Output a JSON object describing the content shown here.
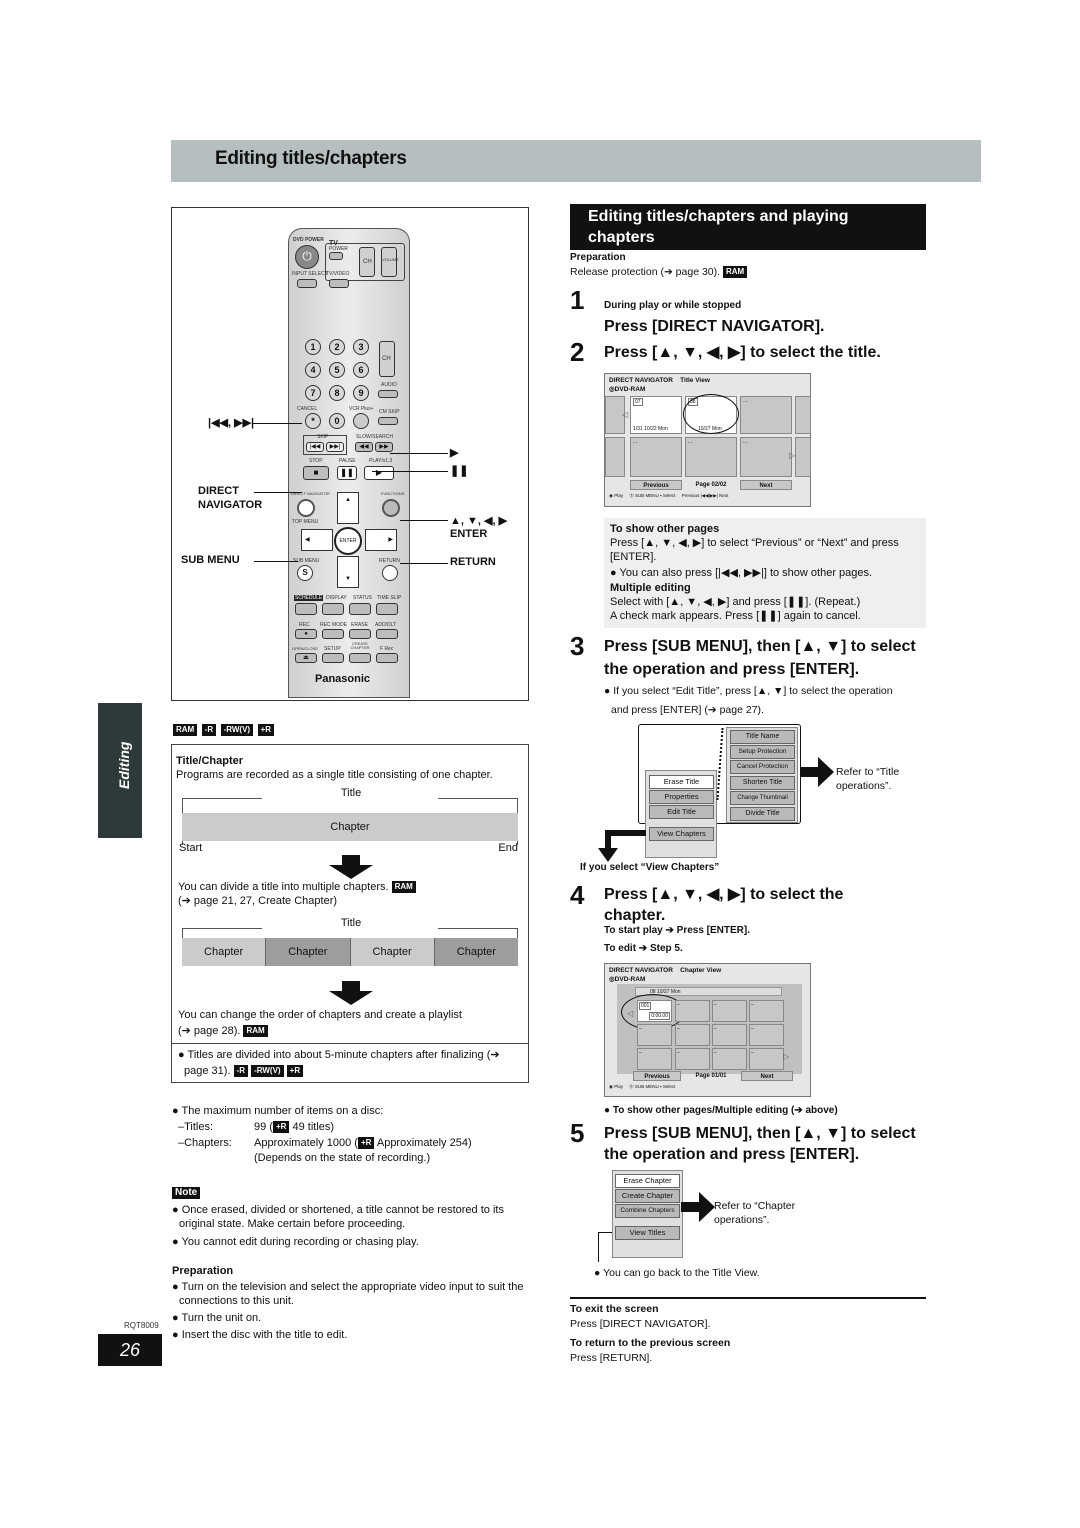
{
  "page": {
    "banner_title": "Editing titles/chapters",
    "side_tab": "Editing",
    "doc_code": "RQT8009",
    "page_number": "26"
  },
  "remote": {
    "labels": {
      "dvd_power": "DVD POWER",
      "tv": "TV",
      "power": "POWER",
      "input_select": "INPUT SELECT",
      "tv_video": "TV/VIDEO",
      "ch": "CH",
      "volume": "VOLUME",
      "audio": "AUDIO",
      "cancel": "CANCEL",
      "vcr_plus": "VCR Plus+",
      "cm_skip": "CM SKIP",
      "skip": "SKIP",
      "slow_search": "SLOW/SEARCH",
      "stop": "STOP",
      "pause": "PAUSE",
      "play": "PLAY/x1.3",
      "direct_navigator": "DIRECT NAVIGATOR",
      "functions": "FUNCTIONS",
      "top_menu": "TOP MENU",
      "enter": "ENTER",
      "sub_menu": "SUB MENU",
      "return": "RETURN",
      "schedule": "SCHEDULE",
      "display": "DISPLAY",
      "status": "STATUS",
      "time_slip": "TIME SLIP",
      "rec": "REC",
      "rec_mode": "REC MODE",
      "erase": "ERASE",
      "add_dlt": "ADD/DLT",
      "open_close": "OPEN/CLOSE",
      "setup": "SETUP",
      "create_chapter": "CREATE CHAPTER",
      "f_rec": "F Rec",
      "brand": "Panasonic"
    },
    "numbers": [
      "1",
      "2",
      "3",
      "4",
      "5",
      "6",
      "7",
      "8",
      "9",
      "0"
    ],
    "callouts": {
      "skip": "|◀◀, ▶▶|",
      "direct_navigator_1": "DIRECT",
      "direct_navigator_2": "NAVIGATOR",
      "sub_menu": "SUB MENU",
      "play": "▶",
      "pause": "❚❚",
      "arrows": "▲, ▼, ◀, ▶",
      "enter": "ENTER",
      "return": "RETURN"
    }
  },
  "media_badges": [
    "RAM",
    "-R",
    "-RW(V)",
    "+R"
  ],
  "title_chapter": {
    "heading": "Title/Chapter",
    "intro": "Programs are recorded as a single title consisting of one chapter.",
    "title_label": "Title",
    "chapter_label": "Chapter",
    "start": "Start",
    "end": "End",
    "divide_text": "You can divide a title into multiple chapters.",
    "divide_badge": "RAM",
    "divide_ref": "(➔ page 21, 27, Create Chapter)",
    "chapters": [
      "Chapter",
      "Chapter",
      "Chapter",
      "Chapter"
    ],
    "order_text": "You can change the order of chapters and create a playlist",
    "order_ref": "(➔ page 28).",
    "order_badge": "RAM",
    "finalize_text": "Titles are divided into about 5-minute chapters after finalizing (➔",
    "finalize_ref": "page 31).",
    "finalize_badges": [
      "-R",
      "-RW(V)",
      "+R"
    ]
  },
  "limits": {
    "intro": "The maximum number of items on a disc:",
    "titles_label": "–Titles:",
    "titles_value_pre": "99 (",
    "titles_badge": "+R",
    "titles_value_post": "49 titles)",
    "chapters_label": "–Chapters:",
    "chapters_value_pre": "Approximately 1000 (",
    "chapters_badge": "+R",
    "chapters_value_post": "Approximately 254)",
    "chapters_note": "(Depends on the state of recording.)"
  },
  "note": {
    "label": "Note",
    "items": [
      "Once erased, divided or shortened, a title cannot be restored to its original state. Make certain before proceeding.",
      "You cannot edit during recording or chasing play."
    ]
  },
  "preparation_left": {
    "heading": "Preparation",
    "items": [
      "Turn on the television and select the appropriate video input to suit the connections to this unit.",
      "Turn the unit on.",
      "Insert the disc with the title to edit."
    ]
  },
  "right": {
    "section_title_1": "Editing titles/chapters and playing",
    "section_title_2": "chapters",
    "prep_heading": "Preparation",
    "prep_text": "Release protection (➔ page 30).",
    "prep_badge": "RAM",
    "step1_num": "1",
    "step1_sub": "During play or while stopped",
    "step1_text": "Press [DIRECT NAVIGATOR].",
    "step2_num": "2",
    "step2_text": "Press [▲, ▼, ◀, ▶] to select the title.",
    "title_view": {
      "header": "DIRECT NAVIGATOR",
      "view": "Title View",
      "disc": "DVD-RAM",
      "thumb1_num": "07",
      "thumb1_date": "1/31 10/22 Mon",
      "thumb2_num": "08",
      "thumb2_date": "10/27 Mon",
      "empty": "- -",
      "previous": "Previous",
      "page": "Page 02/02",
      "next": "Next",
      "footer_play": "Play",
      "footer_submenu": "SUB MENU",
      "footer_select": "Select",
      "footer_prev": "Previous",
      "footer_next": "Next"
    },
    "other_pages": {
      "heading": "To show other pages",
      "line1": "Press [▲, ▼, ◀, ▶] to select “Previous” or “Next” and press",
      "line2": "[ENTER].",
      "bullet": "You can also press [|◀◀, ▶▶|] to show other pages.",
      "multi_heading": "Multiple editing",
      "multi_line1": "Select with [▲, ▼, ◀, ▶] and press [❚❚]. (Repeat.)",
      "multi_line2": "A check mark appears. Press [❚❚] again to cancel."
    },
    "step3_num": "3",
    "step3_line1": "Press [SUB MENU], then [▲, ▼] to select",
    "step3_line2": "the operation and press [ENTER].",
    "step3_bullet_1": "If you select “Edit Title”, press [▲, ▼] to select the operation",
    "step3_bullet_2": "and press [ENTER] (➔ page 27).",
    "title_menu": [
      "Erase Title",
      "Properties",
      "Edit Title",
      "View Chapters"
    ],
    "title_submenu": [
      "Title Name",
      "Setup Protection",
      "Cancel Protection",
      "Shorten Title",
      "Change Thumbnail",
      "Divide Title"
    ],
    "refer_title": "Refer to “Title operations”.",
    "view_chapters_note": "If you select “View Chapters”",
    "step4_num": "4",
    "step4_line1": "Press [▲, ▼, ◀, ▶] to select the",
    "step4_line2": "chapter.",
    "step4_sub1": "To start play ➔ Press [ENTER].",
    "step4_sub2": "To edit ➔ Step 5.",
    "chapter_view": {
      "header": "DIRECT NAVIGATOR",
      "view": "Chapter View",
      "disc": "DVD-RAM",
      "info": "08 10/27 Mon",
      "chap_num": "001",
      "chap_time": "0:00.00",
      "empty": "–",
      "previous": "Previous",
      "page": "Page 01/01",
      "next": "Next",
      "footer_play": "Play",
      "footer_submenu": "SUB MENU",
      "footer_select": "Select"
    },
    "step4_bullet": "To show other pages/Multiple editing (➔ above)",
    "step5_num": "5",
    "step5_line1": "Press [SUB MENU], then [▲, ▼] to select",
    "step5_line2": "the operation and press [ENTER].",
    "chapter_menu": [
      "Erase Chapter",
      "Create Chapter",
      "Combine Chapters",
      "View Titles"
    ],
    "refer_chapter": "Refer to “Chapter operations”.",
    "back_note": "You can go back to the Title View.",
    "exit_heading": "To exit the screen",
    "exit_text": "Press [DIRECT NAVIGATOR].",
    "return_heading": "To return to the previous screen",
    "return_text": "Press [RETURN]."
  }
}
